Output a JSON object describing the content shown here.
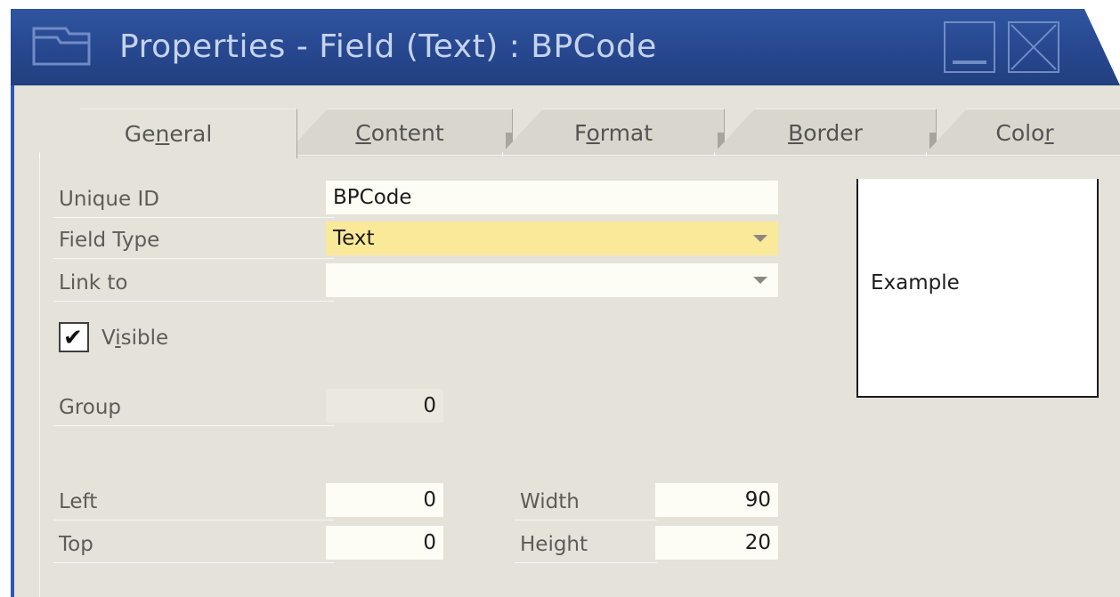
{
  "window": {
    "title": "Properties - Field (Text) : BPCode"
  },
  "tabs": [
    {
      "label_pre": "Ge",
      "label_u": "n",
      "label_post": "eral"
    },
    {
      "label_pre": "",
      "label_u": "C",
      "label_post": "ontent"
    },
    {
      "label_pre": "F",
      "label_u": "o",
      "label_post": "rmat"
    },
    {
      "label_pre": "",
      "label_u": "B",
      "label_post": "order"
    },
    {
      "label_pre": "Colo",
      "label_u": "r",
      "label_post": ""
    }
  ],
  "form": {
    "unique_id": {
      "label": "Unique ID",
      "value": "BPCode"
    },
    "field_type": {
      "label": "Field Type",
      "value": "Text"
    },
    "link_to": {
      "label": "Link to",
      "value": ""
    },
    "visible": {
      "label_pre": "V",
      "label_u": "i",
      "label_post": "sible",
      "checked": true,
      "mark": "✔"
    },
    "group": {
      "label": "Group",
      "value": "0"
    },
    "left": {
      "label": "Left",
      "value": "0"
    },
    "top": {
      "label": "Top",
      "value": "0"
    },
    "width": {
      "label": "Width",
      "value": "90"
    },
    "height": {
      "label": "Height",
      "value": "20"
    }
  },
  "preview": {
    "text": "Example"
  },
  "colors": {
    "titlebar": "#2a4c94",
    "panel": "#e4e2d9",
    "highlight": "#fbe99a"
  }
}
